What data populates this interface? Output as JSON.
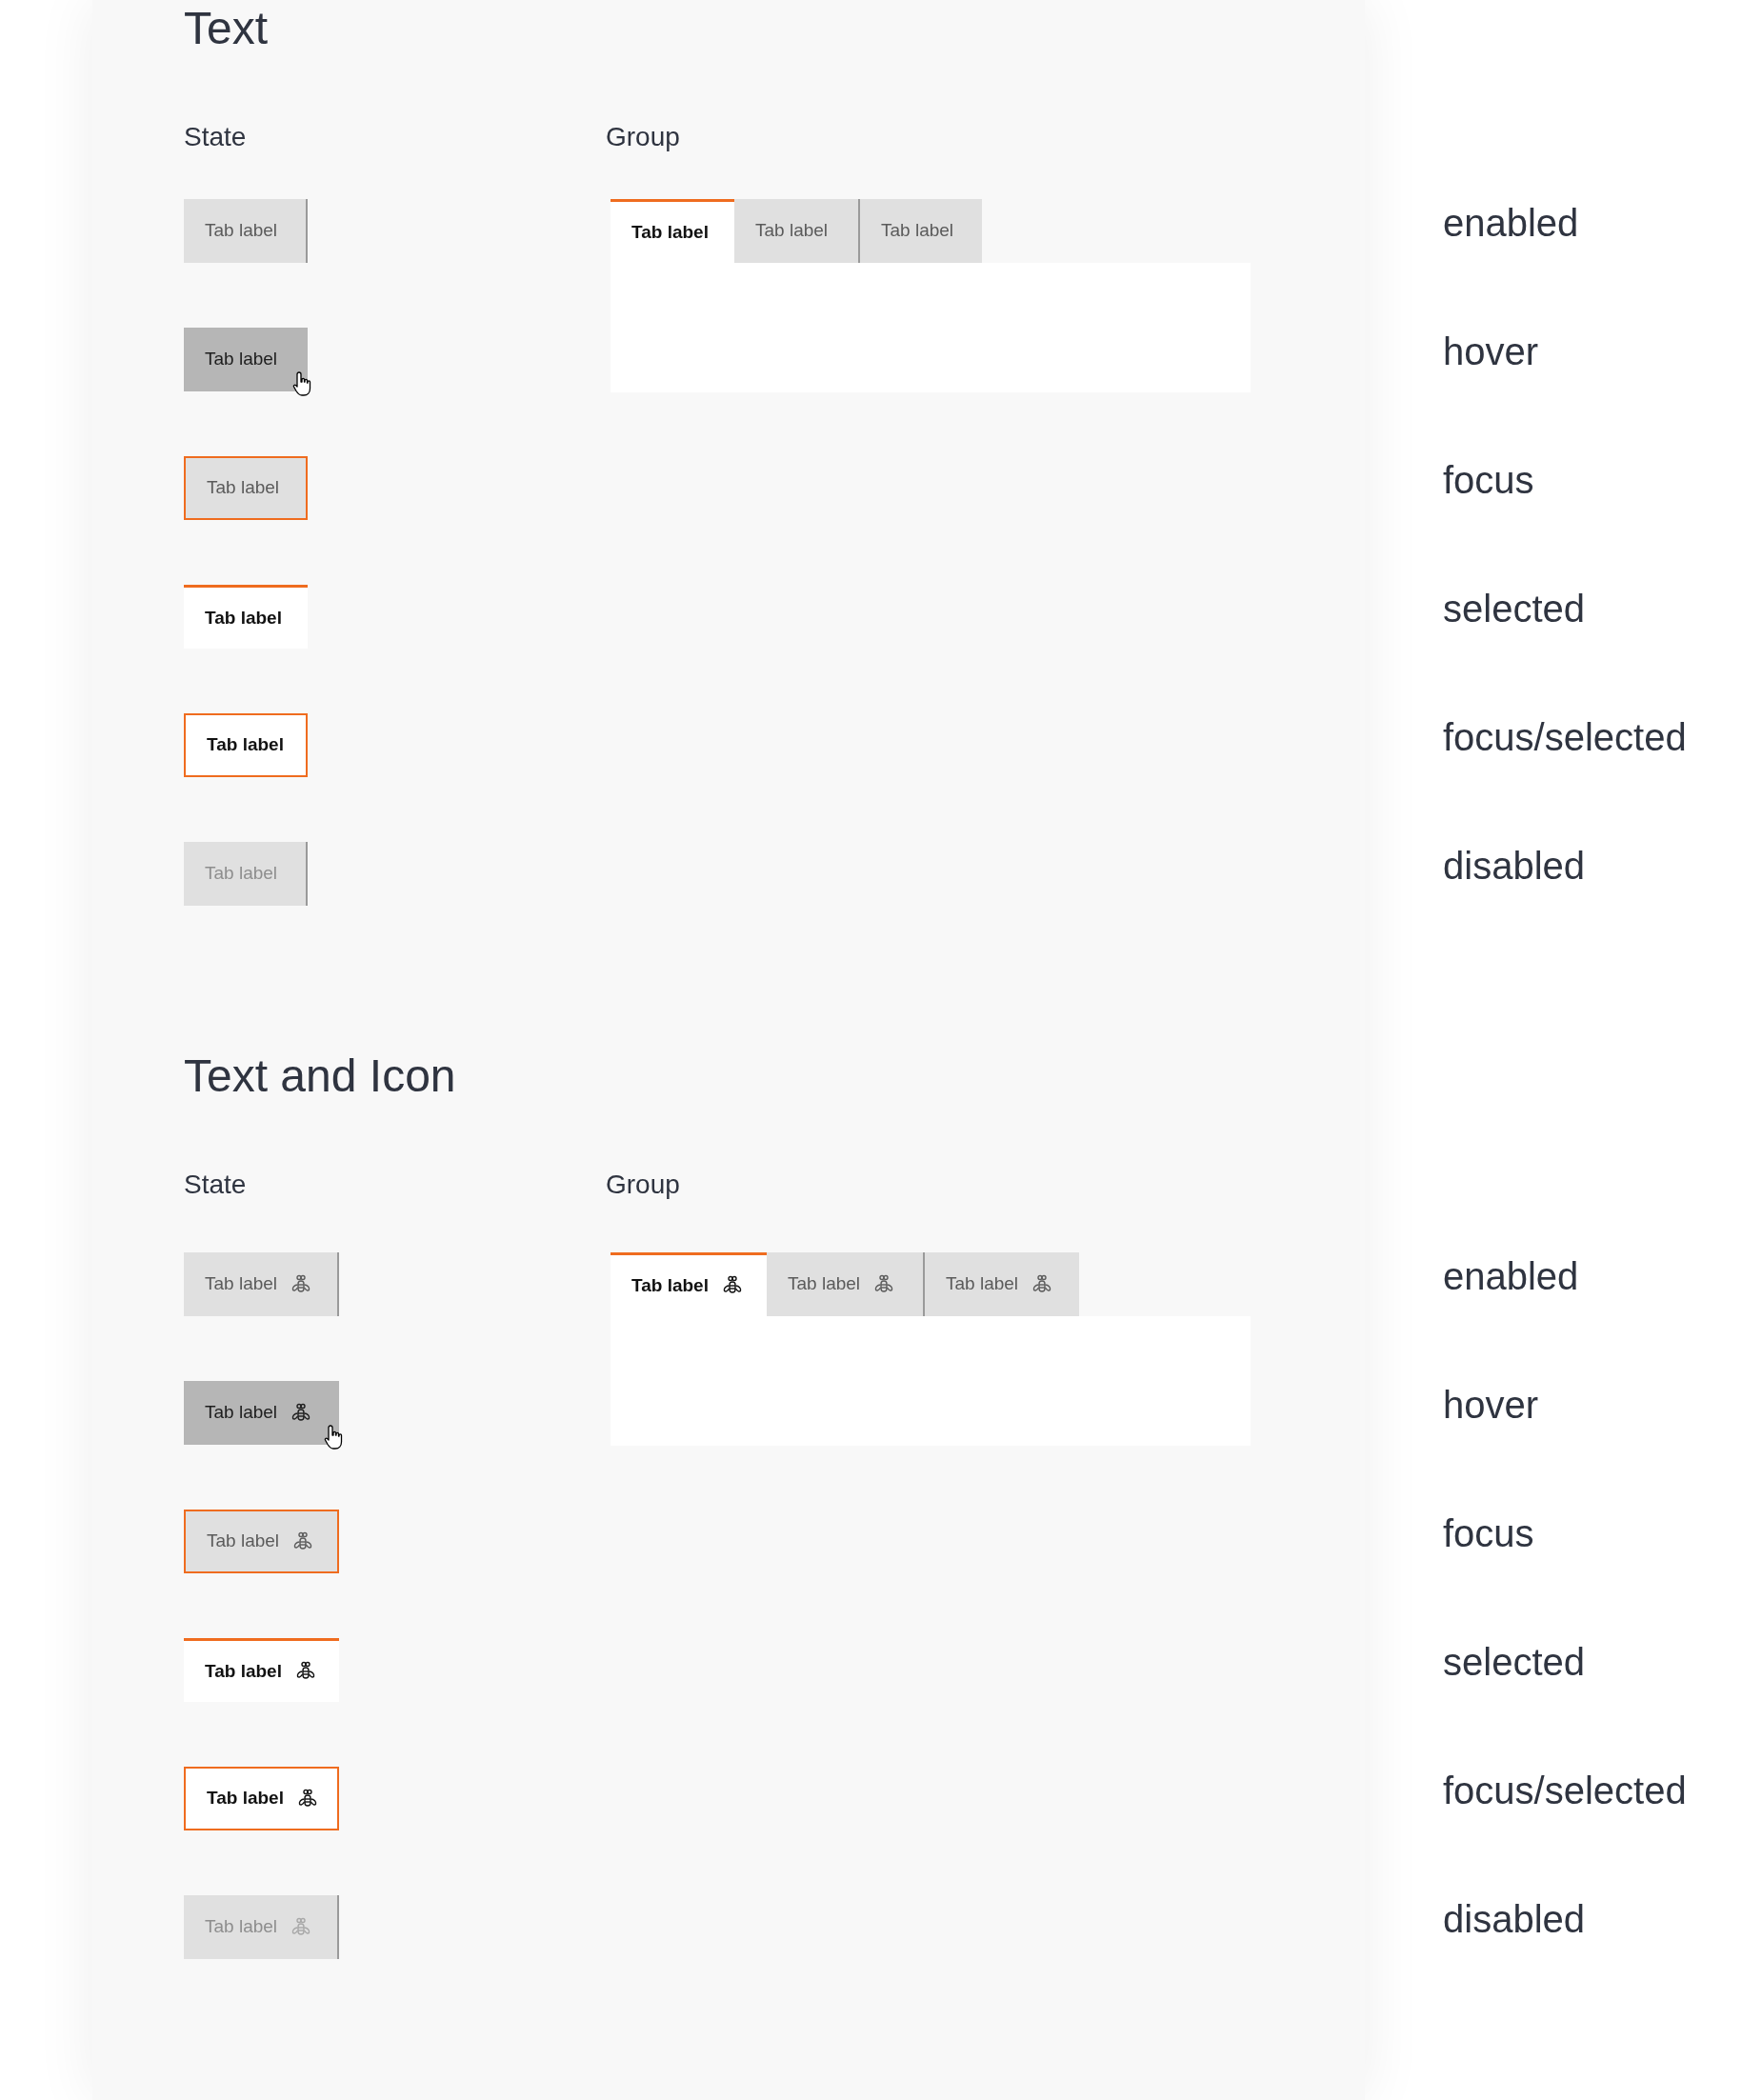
{
  "sections": [
    {
      "title": "Text",
      "state_heading": "State",
      "group_heading": "Group",
      "icon": false,
      "states": [
        {
          "kind": "enabled",
          "label": "Tab label",
          "caption": "enabled"
        },
        {
          "kind": "hover",
          "label": "Tab label",
          "caption": "hover"
        },
        {
          "kind": "focus",
          "label": "Tab label",
          "caption": "focus"
        },
        {
          "kind": "selected",
          "label": "Tab label",
          "caption": "selected"
        },
        {
          "kind": "focus_selected",
          "label": "Tab label",
          "caption": "focus/selected"
        },
        {
          "kind": "disabled",
          "label": "Tab label",
          "caption": "disabled"
        }
      ],
      "group": [
        {
          "label": "Tab label",
          "selected": true
        },
        {
          "label": "Tab label",
          "selected": false
        },
        {
          "label": "Tab label",
          "selected": false
        }
      ]
    },
    {
      "title": "Text and Icon",
      "state_heading": "State",
      "group_heading": "Group",
      "icon": true,
      "states": [
        {
          "kind": "enabled",
          "label": "Tab label",
          "caption": "enabled"
        },
        {
          "kind": "hover",
          "label": "Tab label",
          "caption": "hover"
        },
        {
          "kind": "focus",
          "label": "Tab label",
          "caption": "focus"
        },
        {
          "kind": "selected",
          "label": "Tab label",
          "caption": "selected"
        },
        {
          "kind": "focus_selected",
          "label": "Tab label",
          "caption": "focus/selected"
        },
        {
          "kind": "disabled",
          "label": "Tab label",
          "caption": "disabled"
        }
      ],
      "group": [
        {
          "label": "Tab label",
          "selected": true
        },
        {
          "label": "Tab label",
          "selected": false
        },
        {
          "label": "Tab label",
          "selected": false
        }
      ]
    }
  ]
}
